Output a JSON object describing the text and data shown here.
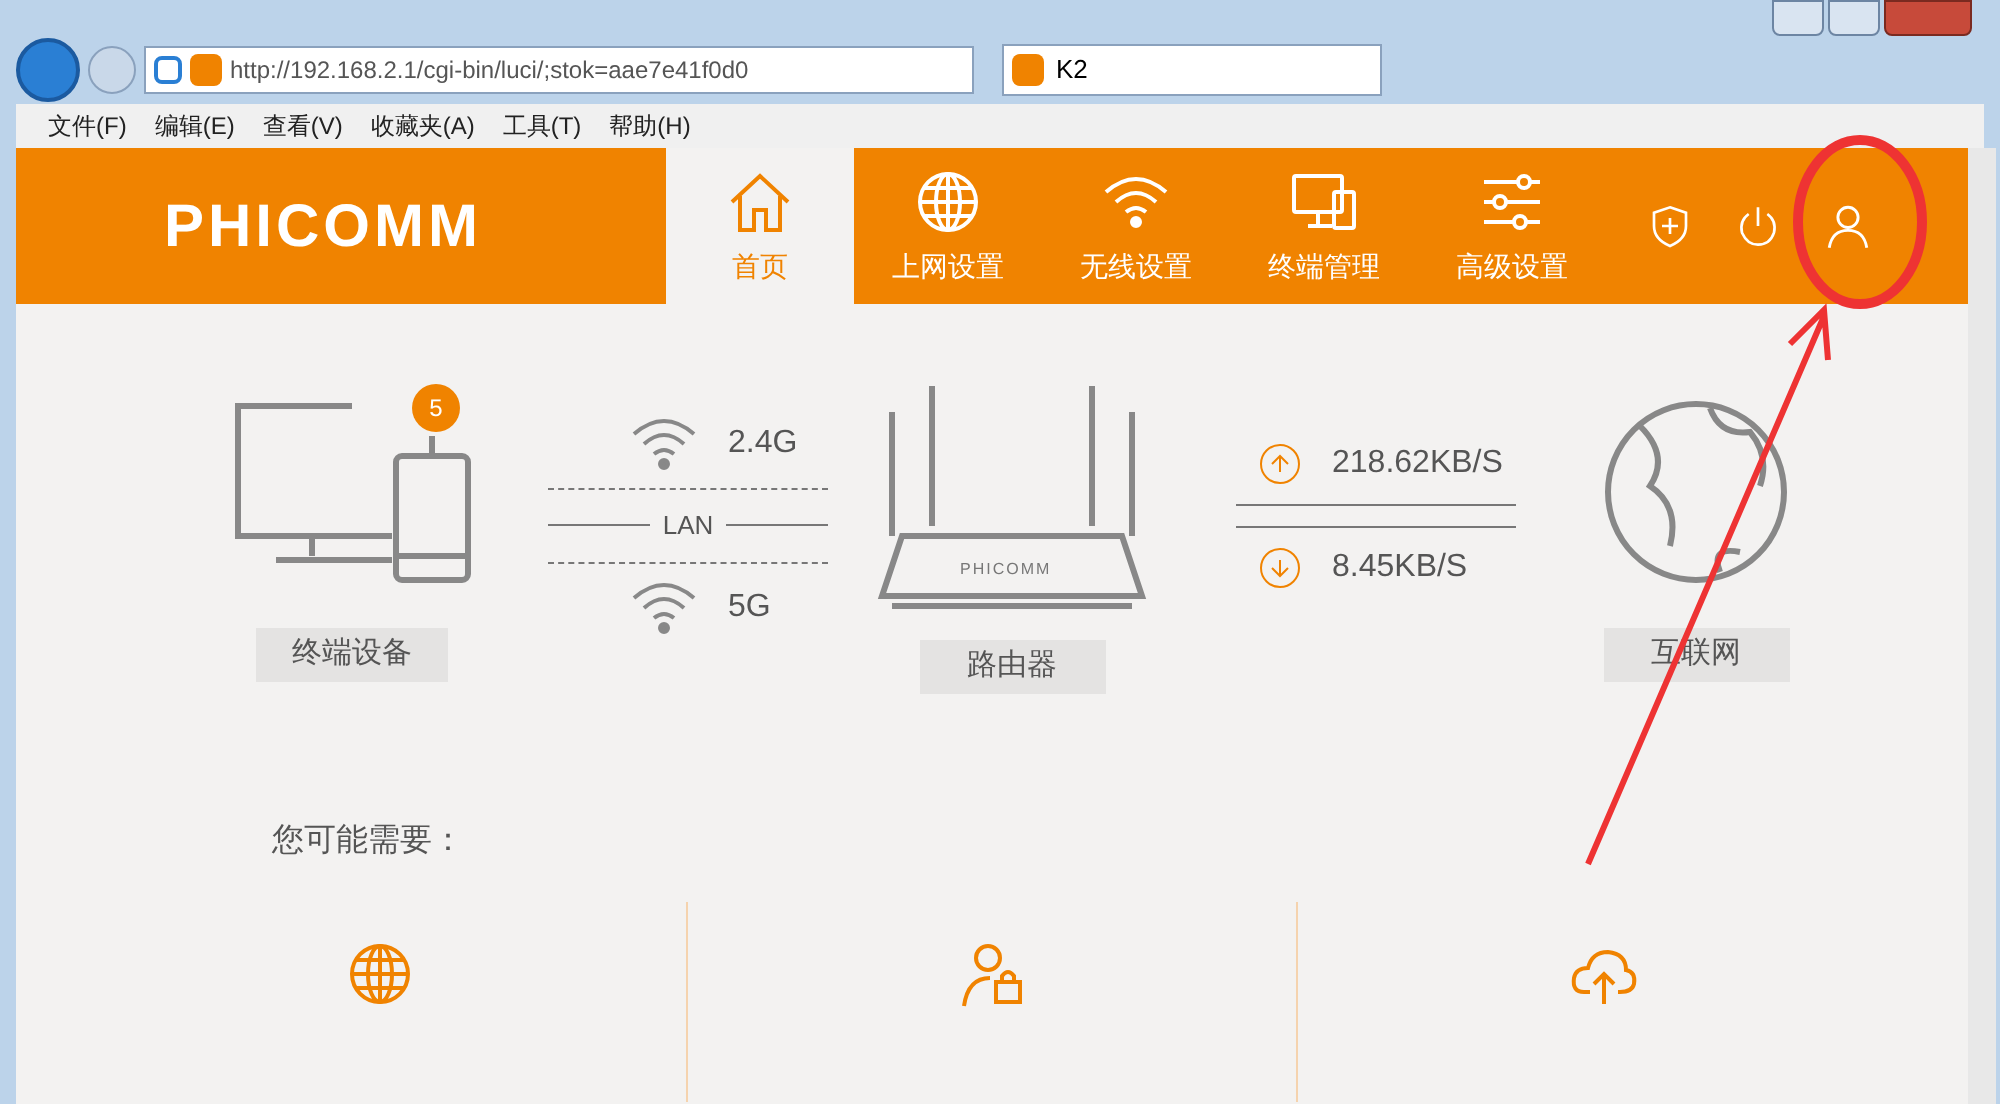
{
  "browser": {
    "url": "http://192.168.2.1/cgi-bin/luci/;stok=aae7e41f0d0",
    "tab_title": "K2",
    "menu": [
      "文件(F)",
      "编辑(E)",
      "查看(V)",
      "收藏夹(A)",
      "工具(T)",
      "帮助(H)"
    ]
  },
  "header": {
    "logo": "PHICOMM",
    "nav": [
      {
        "label": "首页",
        "selected": true
      },
      {
        "label": "上网设置",
        "selected": false
      },
      {
        "label": "无线设置",
        "selected": false
      },
      {
        "label": "终端管理",
        "selected": false
      },
      {
        "label": "高级设置",
        "selected": false
      }
    ]
  },
  "status": {
    "devices_label": "终端设备",
    "device_count": "5",
    "band_1": "2.4G",
    "lan": "LAN",
    "band_2": "5G",
    "router_label": "路由器",
    "router_brand": "PHICOMM",
    "upload": "218.62KB/S",
    "download": "8.45KB/S",
    "internet_label": "互联网"
  },
  "suggest": {
    "title": "您可能需要："
  }
}
